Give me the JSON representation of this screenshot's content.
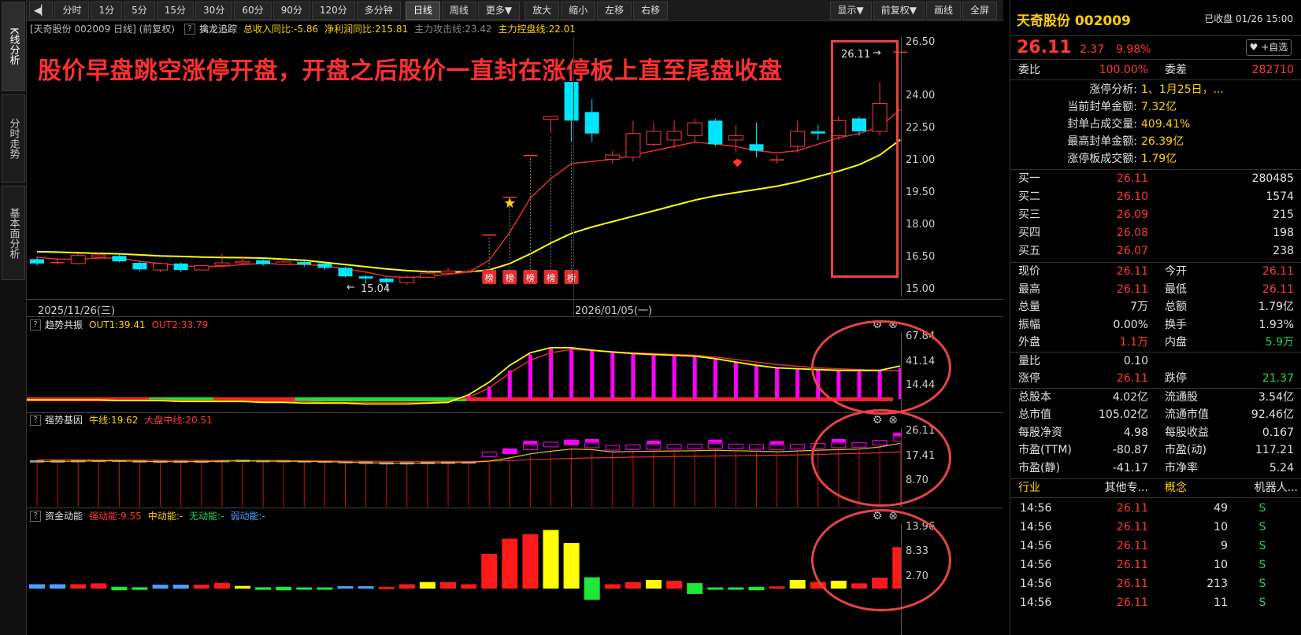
{
  "toolbar": {
    "items": [
      "分时",
      "1分",
      "5分",
      "15分",
      "30分",
      "60分",
      "90分",
      "120分",
      "多分钟",
      "日线",
      "周线",
      "更多▼",
      "放大",
      "缩小",
      "左移",
      "右移"
    ],
    "active_index": 9,
    "right_items": [
      "显示▼",
      "前复权▼",
      "画线",
      "全屏"
    ]
  },
  "left_tabs": [
    "K线分析",
    "分时走势",
    "基本面分析"
  ],
  "main": {
    "info": {
      "title": "[天奇股份 002009 日线] (前复权)",
      "indicator": "擒龙追踪",
      "rev": "总收入同比:-5.86",
      "profit": "净利润同比:215.81",
      "attack": "主力攻击线:23.42",
      "control": "主力控盘线:22.01"
    },
    "annotation": "股价早盘跳空涨停开盘，开盘之后股价一直封在涨停板上直至尾盘收盘",
    "last_label": "26.11",
    "low_label": "15.04",
    "dates": [
      "2025/11/26(三)",
      "2026/01/05(一)"
    ],
    "badge": "榜",
    "axis": [
      "26.50",
      "24.00",
      "22.50",
      "21.00",
      "19.50",
      "18.00",
      "16.50",
      "15.00"
    ]
  },
  "panels": {
    "trend": {
      "name": "趋势共振",
      "out1": "OUT1:39.41",
      "out2": "OUT2:33.79",
      "axis": [
        "67.84",
        "41.14",
        "14.44"
      ]
    },
    "strong": {
      "name": "强势基因",
      "bull": "牛线:19.62",
      "market": "大盘中线:20.51",
      "axis": [
        "26.11",
        "17.41",
        "8.70"
      ]
    },
    "fund": {
      "name": "资金动能",
      "s1": "强动能:9.55",
      "s2": "中动能:-",
      "s3": "无动能:-",
      "s4": "弱动能:-",
      "axis": [
        "13.96",
        "8.33",
        "2.70"
      ]
    }
  },
  "colors": {
    "up": "#ff3838",
    "down": "#00e5ff",
    "ma1": "#ffff00",
    "ma2": "#e03030",
    "magenta": "#ff00ff",
    "green": "#22d25a"
  },
  "right": {
    "name": "天奇股份 002009",
    "closed": "已收盘 01/26 15:00",
    "price": "26.11",
    "change": "2.37",
    "pct": "9.98%",
    "fav": "♥ +自选",
    "weibi": {
      "l": "委比",
      "v": "100.00%",
      "l2": "委差",
      "v2": "282710"
    },
    "limit": [
      {
        "l": "涨停分析:",
        "v": "1、1月25日，..."
      },
      {
        "l": "当前封单金额:",
        "v": "7.32亿"
      },
      {
        "l": "封单占成交量:",
        "v": "409.41%"
      },
      {
        "l": "最高封单金额:",
        "v": "26.39亿"
      },
      {
        "l": "涨停板成交额:",
        "v": "1.79亿"
      }
    ],
    "bids": [
      {
        "l": "买一",
        "p": "26.11",
        "v": "280485"
      },
      {
        "l": "买二",
        "p": "26.10",
        "v": "1574"
      },
      {
        "l": "买三",
        "p": "26.09",
        "v": "215"
      },
      {
        "l": "买四",
        "p": "26.08",
        "v": "198"
      },
      {
        "l": "买五",
        "p": "26.07",
        "v": "238"
      }
    ],
    "quote": [
      {
        "l1": "现价",
        "v1": "26.11",
        "c1": "red",
        "l2": "今开",
        "v2": "26.11",
        "c2": "red"
      },
      {
        "l1": "最高",
        "v1": "26.11",
        "c1": "red",
        "l2": "最低",
        "v2": "26.11",
        "c2": "red"
      },
      {
        "l1": "总量",
        "v1": "7万",
        "c1": "white",
        "l2": "总额",
        "v2": "1.79亿",
        "c2": "white"
      },
      {
        "l1": "振幅",
        "v1": "0.00%",
        "c1": "white",
        "l2": "换手",
        "v2": "1.93%",
        "c2": "white"
      },
      {
        "l1": "外盘",
        "v1": "1.1万",
        "c1": "red",
        "l2": "内盘",
        "v2": "5.9万",
        "c2": "green"
      },
      {
        "l1": "量比",
        "v1": "0.10",
        "c1": "white",
        "l2": "",
        "v2": "",
        "c2": "white"
      },
      {
        "l1": "涨停",
        "v1": "26.11",
        "c1": "red",
        "l2": "跌停",
        "v2": "21.37",
        "c2": "green"
      },
      {
        "l1": "总股本",
        "v1": "4.02亿",
        "c1": "white",
        "l2": "流通股",
        "v2": "3.54亿",
        "c2": "white"
      },
      {
        "l1": "总市值",
        "v1": "105.02亿",
        "c1": "white",
        "l2": "流通市值",
        "v2": "92.46亿",
        "c2": "white"
      },
      {
        "l1": "每股净资",
        "v1": "4.98",
        "c1": "white",
        "l2": "每股收益",
        "v2": "0.167",
        "c2": "white"
      },
      {
        "l1": "市盈(TTM)",
        "v1": "-80.87",
        "c1": "white",
        "l2": "市盈(动)",
        "v2": "117.21",
        "c2": "white"
      },
      {
        "l1": "市盈(静)",
        "v1": "-41.17",
        "c1": "white",
        "l2": "市净率",
        "v2": "5.24",
        "c2": "white"
      }
    ],
    "industry": {
      "l": "行业",
      "v": "其他专...",
      "l2": "概念",
      "v2": "机器人..."
    },
    "ticks": [
      {
        "t": "14:56",
        "p": "26.11",
        "v": "49",
        "s": "S"
      },
      {
        "t": "14:56",
        "p": "26.11",
        "v": "10",
        "s": "S"
      },
      {
        "t": "14:56",
        "p": "26.11",
        "v": "9",
        "s": "S"
      },
      {
        "t": "14:56",
        "p": "26.11",
        "v": "10",
        "s": "S"
      },
      {
        "t": "14:56",
        "p": "26.11",
        "v": "213",
        "s": "S"
      },
      {
        "t": "14:56",
        "p": "26.11",
        "v": "11",
        "s": "S"
      }
    ]
  },
  "chart_data": {
    "type": "candlestick",
    "ylim": [
      15.0,
      26.5
    ],
    "candles": [
      [
        16.45,
        16.25,
        16.55,
        16.15
      ],
      [
        16.3,
        16.32,
        16.5,
        16.2
      ],
      [
        16.25,
        16.62,
        16.7,
        16.2
      ],
      [
        16.55,
        16.65,
        16.75,
        16.45
      ],
      [
        16.6,
        16.35,
        16.65,
        16.3
      ],
      [
        16.28,
        15.98,
        16.35,
        15.9
      ],
      [
        15.95,
        16.25,
        16.3,
        15.85
      ],
      [
        16.25,
        15.95,
        16.3,
        15.85
      ],
      [
        15.95,
        16.15,
        16.2,
        15.9
      ],
      [
        16.15,
        16.28,
        16.7,
        16.1
      ],
      [
        16.28,
        16.35,
        16.6,
        16.2
      ],
      [
        16.4,
        16.22,
        16.5,
        16.15
      ],
      [
        16.2,
        16.32,
        16.45,
        16.15
      ],
      [
        16.32,
        16.2,
        16.45,
        16.1
      ],
      [
        16.25,
        16.05,
        16.3,
        15.95
      ],
      [
        16.05,
        15.65,
        16.1,
        15.6
      ],
      [
        15.65,
        15.55,
        15.7,
        15.3
      ],
      [
        15.55,
        15.38,
        15.6,
        15.04
      ],
      [
        15.35,
        15.6,
        15.7,
        15.25
      ],
      [
        15.6,
        15.8,
        15.9,
        15.55
      ],
      [
        15.8,
        15.9,
        16.05,
        15.7
      ],
      [
        15.9,
        15.9,
        16.0,
        15.85
      ],
      [
        17.6,
        17.6,
        17.6,
        17.6
      ],
      [
        19.36,
        19.36,
        19.36,
        19.36
      ],
      [
        21.3,
        21.3,
        21.3,
        21.3
      ],
      [
        22.96,
        23.1,
        23.1,
        22.3
      ],
      [
        24.7,
        22.9,
        24.7,
        21.9
      ],
      [
        23.3,
        22.3,
        23.9,
        21.9
      ],
      [
        21.1,
        21.3,
        21.5,
        20.9
      ],
      [
        21.2,
        22.3,
        22.9,
        21.0
      ],
      [
        21.8,
        22.4,
        22.8,
        21.7
      ],
      [
        22.0,
        22.4,
        22.9,
        21.6
      ],
      [
        22.2,
        22.8,
        23.0,
        21.9
      ],
      [
        22.9,
        21.8,
        23.0,
        21.7
      ],
      [
        22.0,
        22.2,
        22.7,
        21.4
      ],
      [
        21.8,
        21.5,
        22.8,
        21.2
      ],
      [
        21.1,
        21.1,
        21.3,
        20.9
      ],
      [
        21.7,
        22.4,
        22.9,
        21.4
      ],
      [
        22.4,
        22.3,
        22.7,
        22.0
      ],
      [
        22.2,
        22.9,
        23.1,
        22.0
      ],
      [
        23.0,
        22.4,
        23.1,
        22.2
      ],
      [
        22.4,
        23.7,
        24.7,
        22.2
      ],
      [
        26.11,
        26.11,
        26.11,
        26.11
      ]
    ],
    "ma_attack": [
      16.55,
      16.45,
      16.45,
      16.5,
      16.5,
      16.35,
      16.25,
      16.15,
      16.1,
      16.12,
      16.2,
      16.25,
      16.22,
      16.2,
      16.15,
      16.0,
      15.85,
      15.65,
      15.6,
      15.65,
      15.75,
      15.85,
      16.4,
      17.7,
      19.3,
      20.2,
      20.9,
      21.0,
      21.1,
      21.3,
      21.5,
      21.7,
      21.9,
      21.8,
      21.7,
      21.5,
      21.4,
      21.5,
      21.8,
      22.1,
      22.3,
      22.6,
      23.42
    ],
    "ma_control": [
      16.8,
      16.78,
      16.75,
      16.72,
      16.7,
      16.65,
      16.6,
      16.58,
      16.55,
      16.53,
      16.52,
      16.5,
      16.45,
      16.4,
      16.3,
      16.2,
      16.1,
      16.0,
      15.92,
      15.87,
      15.86,
      15.86,
      15.95,
      16.25,
      16.7,
      17.2,
      17.65,
      17.95,
      18.2,
      18.45,
      18.7,
      18.95,
      19.2,
      19.4,
      19.55,
      19.7,
      19.85,
      20.05,
      20.3,
      20.55,
      20.85,
      21.3,
      22.01
    ],
    "badges": [
      22,
      23,
      24,
      25,
      27
    ],
    "trend": {
      "ylim": [
        0,
        75
      ],
      "bars": [
        0,
        0,
        0,
        0,
        0,
        0,
        0,
        0,
        0,
        0,
        0,
        0,
        0,
        0,
        0,
        0,
        0,
        0,
        0,
        0,
        0,
        0,
        5,
        15,
        34,
        53,
        60,
        61,
        59,
        56,
        54,
        53,
        52,
        51,
        48,
        44,
        40,
        37,
        36,
        35,
        34,
        34,
        34,
        37
      ],
      "out1": [
        -1,
        -1,
        -1,
        -1,
        -1,
        -2,
        -2,
        -2,
        -3,
        -3,
        -3,
        -3,
        -4,
        -4,
        -5,
        -5,
        -5,
        -6,
        -6,
        -6,
        -5,
        -4,
        5,
        20,
        40,
        55,
        61,
        61,
        58,
        56,
        54,
        53,
        52,
        51,
        48,
        44,
        40,
        37,
        36,
        35,
        34,
        34,
        34,
        39.41
      ],
      "out2": [
        0,
        0,
        0,
        0,
        -1,
        -1,
        -1,
        -1,
        -2,
        -2,
        -2,
        -2,
        -3,
        -3,
        -3,
        -4,
        -4,
        -4,
        -4,
        -4,
        -4,
        -3,
        2,
        13,
        31,
        46,
        55,
        59,
        58,
        56,
        55,
        54,
        53,
        52,
        50,
        47,
        44,
        41,
        39,
        37,
        36,
        35,
        34,
        33.79
      ]
    },
    "strong": {
      "ylim": [
        0,
        28
      ],
      "bull": [
        17.0,
        17.0,
        17.1,
        17.2,
        17.2,
        17.0,
        16.9,
        16.9,
        16.9,
        17.1,
        17.2,
        17.1,
        17.1,
        17.0,
        16.9,
        16.7,
        16.5,
        16.3,
        16.3,
        16.4,
        16.5,
        16.6,
        17.1,
        18.3,
        19.8,
        20.8,
        21.6,
        21.4,
        20.5,
        20.7,
        20.8,
        20.9,
        21.0,
        21.2,
        21.0,
        20.8,
        20.6,
        20.9,
        21.2,
        21.4,
        21.6,
        22.4,
        23.8
      ],
      "market": [
        17.6,
        17.6,
        17.6,
        17.5,
        17.5,
        17.5,
        17.4,
        17.4,
        17.4,
        17.3,
        17.3,
        17.3,
        17.3,
        17.2,
        17.2,
        17.1,
        17.1,
        17.0,
        17.0,
        17.0,
        17.0,
        17.0,
        17.1,
        17.3,
        17.6,
        17.9,
        18.1,
        18.3,
        18.4,
        18.6,
        18.7,
        18.8,
        18.9,
        19.0,
        19.1,
        19.2,
        19.3,
        19.4,
        19.6,
        19.8,
        20.0,
        20.2,
        20.51
      ]
    },
    "fund": {
      "ylim": [
        0,
        14.5
      ],
      "values": [
        1.0,
        1.0,
        1.0,
        1.2,
        0.8,
        0.6,
        0.9,
        0.9,
        0.9,
        1.3,
        0.6,
        0.6,
        0.8,
        0.5,
        0.4,
        0.3,
        0.3,
        0.4,
        1.0,
        1.5,
        1.5,
        1.0,
        8.0,
        11.5,
        12.5,
        13.5,
        10.5,
        5.2,
        1.0,
        1.5,
        2.0,
        1.8,
        2.5,
        0.5,
        0.5,
        0.8,
        0.5,
        2.0,
        1.5,
        1.8,
        1.2,
        2.5,
        9.55
      ],
      "kinds": [
        "b",
        "b",
        "r",
        "r",
        "g",
        "g",
        "b",
        "b",
        "r",
        "r",
        "y",
        "g",
        "g",
        "g",
        "g",
        "b",
        "b",
        "r",
        "r",
        "y",
        "r",
        "r",
        "r",
        "r",
        "r",
        "y",
        "y",
        "g",
        "r",
        "r",
        "y",
        "r",
        "g",
        "g",
        "g",
        "g",
        "r",
        "y",
        "r",
        "y",
        "r",
        "r",
        "r"
      ]
    }
  }
}
